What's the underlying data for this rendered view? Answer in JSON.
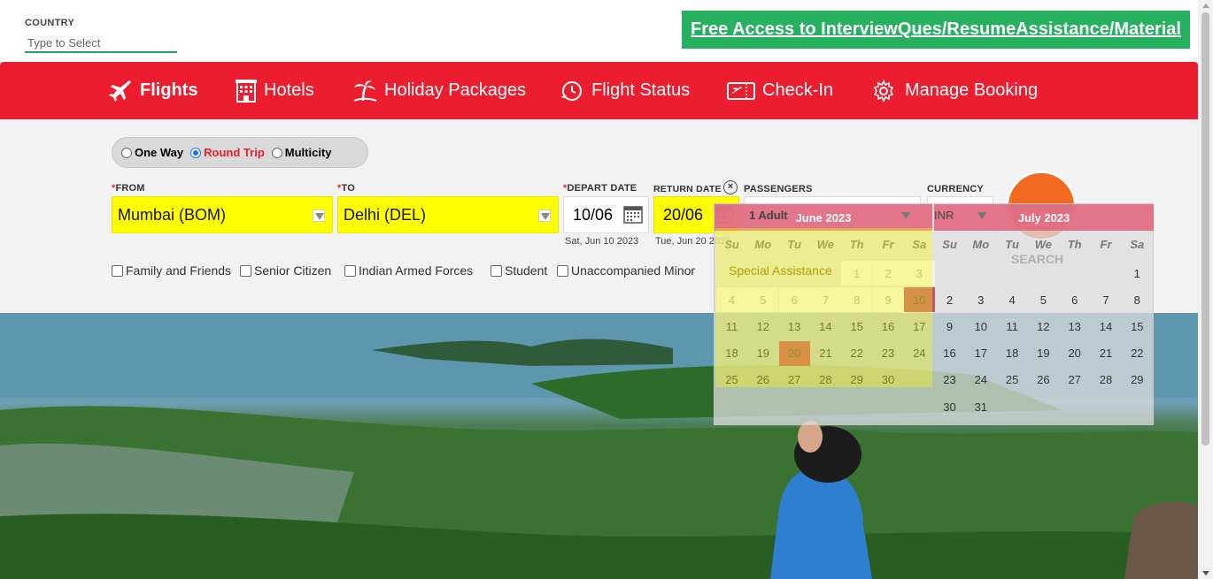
{
  "country": {
    "label": "COUNTRY",
    "placeholder": "Type to Select"
  },
  "promo": {
    "text": "Free Access to InterviewQues/ResumeAssistance/Material"
  },
  "nav": {
    "items": [
      {
        "label": "Flights",
        "icon": "plane-icon"
      },
      {
        "label": "Hotels",
        "icon": "hotel-icon"
      },
      {
        "label": "Holiday Packages",
        "icon": "palm-tree-icon"
      },
      {
        "label": "Flight Status",
        "icon": "clock-plane-icon"
      },
      {
        "label": "Check-In",
        "icon": "boarding-pass-icon"
      },
      {
        "label": "Manage Booking",
        "icon": "gear-icon"
      }
    ]
  },
  "trip": {
    "one_way": "One Way",
    "round_trip": "Round Trip",
    "multicity": "Multicity",
    "selected": "Round Trip"
  },
  "form": {
    "from_label": "FROM",
    "to_label": "TO",
    "depart_label": "DEPART DATE",
    "return_label": "RETURN DATE",
    "passengers_label": "PASSENGERS",
    "currency_label": "CURRENCY",
    "from_value": "Mumbai (BOM)",
    "to_value": "Delhi (DEL)",
    "depart_value": "10/06",
    "depart_sub": "Sat, Jun 10 2023",
    "return_value": "20/06",
    "return_sub": "Tue, Jun 20 2023",
    "passengers_value": "1 Adult",
    "currency_value": "INR",
    "search_label": "SEARCH",
    "required_mark": "*",
    "clear_mark": "×"
  },
  "checkboxes": [
    "Family and Friends",
    "Senior Citizen",
    "Indian Armed Forces",
    "Student",
    "Unaccompanied Minor"
  ],
  "special_assistance": "Special Assistance",
  "calendar": {
    "months": [
      {
        "title": "June 2023",
        "dow": [
          "Su",
          "Mo",
          "Tu",
          "We",
          "Th",
          "Fr",
          "Sa"
        ],
        "rows": [
          [
            "",
            "",
            "",
            "",
            "1",
            "2",
            "3"
          ],
          [
            "4",
            "5",
            "6",
            "7",
            "8",
            "9",
            "10"
          ],
          [
            "11",
            "12",
            "13",
            "14",
            "15",
            "16",
            "17"
          ],
          [
            "18",
            "19",
            "20",
            "21",
            "22",
            "23",
            "24"
          ],
          [
            "25",
            "26",
            "27",
            "28",
            "29",
            "30",
            ""
          ]
        ],
        "selected": [
          "10",
          "20"
        ]
      },
      {
        "title": "July 2023",
        "dow": [
          "Su",
          "Mo",
          "Tu",
          "We",
          "Th",
          "Fr",
          "Sa"
        ],
        "rows": [
          [
            "",
            "",
            "",
            "",
            "",
            "",
            "1"
          ],
          [
            "2",
            "3",
            "4",
            "5",
            "6",
            "7",
            "8"
          ],
          [
            "9",
            "10",
            "11",
            "12",
            "13",
            "14",
            "15"
          ],
          [
            "16",
            "17",
            "18",
            "19",
            "20",
            "21",
            "22"
          ],
          [
            "23",
            "24",
            "25",
            "26",
            "27",
            "28",
            "29"
          ],
          [
            "30",
            "31",
            "",
            "",
            "",
            "",
            ""
          ]
        ],
        "selected": []
      }
    ]
  },
  "colors": {
    "brand_red": "#ec1d2e",
    "promo_green": "#25b15f",
    "field_yellow": "#ffff00",
    "selected_day": "#c0566e"
  }
}
